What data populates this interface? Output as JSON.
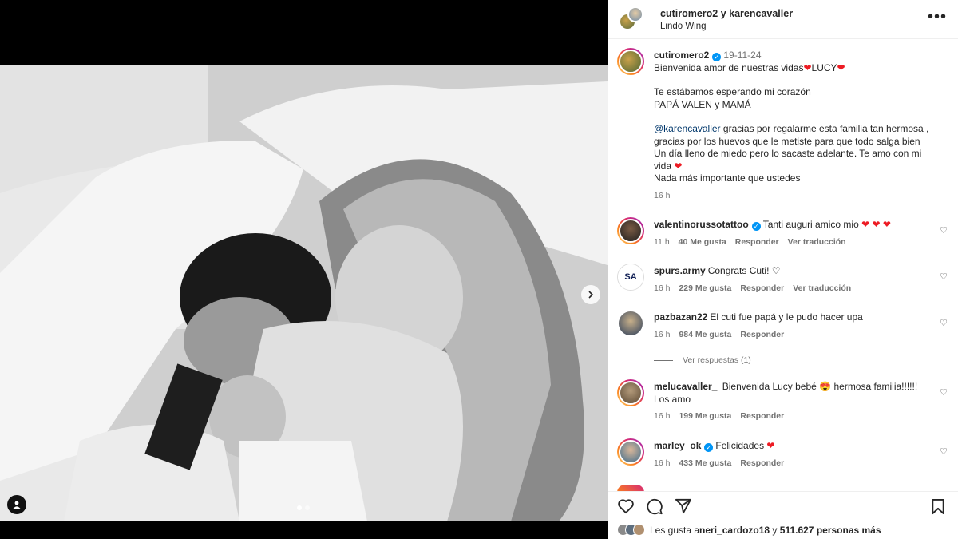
{
  "header": {
    "names": "cutiromero2 y karencavaller",
    "subtitle": "Lindo Wing",
    "more_label": "•••"
  },
  "caption": {
    "user": "cutiromero2",
    "date": "19-11-24",
    "line1": "Bienvenida amor de nuestras vidas",
    "lucy": "LUCY",
    "line2": "Te estábamos esperando mi corazón",
    "line3": "PAPÁ VALEN y MAMÁ",
    "mention": "@karencavaller",
    "line4": " gracias por regalarme esta familia tan hermosa ,",
    "line5": "gracias por los huevos que le metiste para que todo salga bien",
    "line6": "Un día lleno de miedo pero lo sacaste adelante. Te amo con mi",
    "line7": "vida",
    "line8": "Nada más importante que ustedes",
    "time": "16 h"
  },
  "comments": [
    {
      "user": "valentinorussotattoo",
      "verified": true,
      "text": "Tanti auguri amico mio ",
      "time": "11 h",
      "likes": "40 Me gusta",
      "reply": "Responder",
      "translate": "Ver traducción"
    },
    {
      "user": "spurs.army",
      "verified": false,
      "text": "Congrats Cuti! ",
      "time": "16 h",
      "likes": "229 Me gusta",
      "reply": "Responder",
      "translate": "Ver traducción"
    },
    {
      "user": "pazbazan22",
      "verified": false,
      "text": "El cuti fue papá y le pudo hacer upa",
      "time": "16 h",
      "likes": "984 Me gusta",
      "reply": "Responder",
      "view_replies": "Ver respuestas (1)"
    },
    {
      "user": "melucavaller_",
      "verified": false,
      "text": "Bienvenida Lucy bebé",
      "text2": "hermosa familia!!!!!!",
      "text3": "Los amo",
      "time": "16 h",
      "likes": "199 Me gusta",
      "reply": "Responder"
    },
    {
      "user": "marley_ok",
      "verified": true,
      "text": "Felicidades",
      "time": "16 h",
      "likes": "433 Me gusta",
      "reply": "Responder"
    }
  ],
  "likes_bar": {
    "prefix": "Les gusta a ",
    "user": "neri_cardozo18",
    "mid": " y ",
    "count": "511.627 personas más"
  },
  "icons": {
    "heart": "heart-icon",
    "comment": "comment-icon",
    "share": "share-icon",
    "save": "bookmark-icon",
    "next": "chevron-right-icon",
    "tag": "user-tag-icon"
  },
  "colors": {
    "verified": "#0095f6",
    "mention": "#00376b",
    "heart": "#ed1c24",
    "muted": "#737373"
  }
}
